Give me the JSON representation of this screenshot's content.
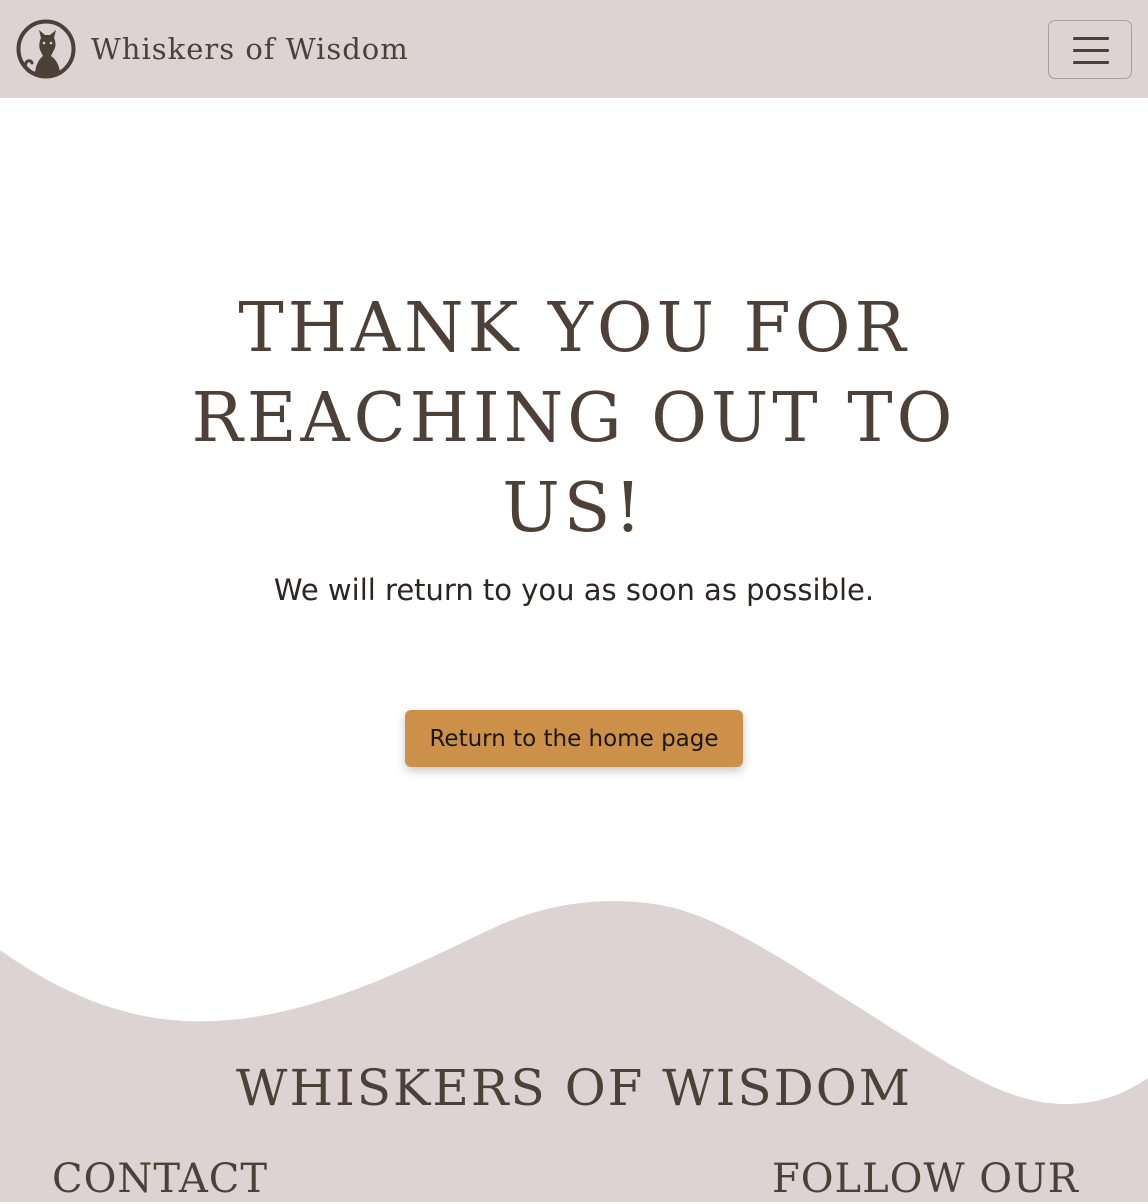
{
  "navbar": {
    "brand_name": "Whiskers of Wisdom",
    "logo_icon": "cat-icon",
    "toggle_icon": "hamburger-menu-icon"
  },
  "hero": {
    "title": "Thank you for reaching out to us!",
    "subtitle": "We will return to you as soon as possible.",
    "button_label": "Return to the home page"
  },
  "footer": {
    "brand_name": "Whiskers of Wisdom",
    "contact_heading": "Contact",
    "follow_heading": "Follow our"
  },
  "colors": {
    "navbar_bg": "#ddd3d3",
    "footer_bg": "#ddd3d3",
    "text_brown": "#4c4038",
    "button_bg": "#cd9049",
    "page_bg": "#ffffff"
  }
}
